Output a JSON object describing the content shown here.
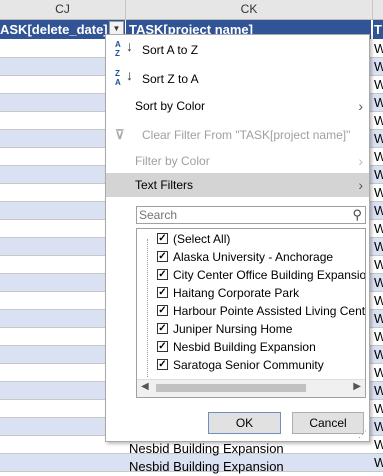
{
  "columns": {
    "cj": "CJ",
    "ck": "CK"
  },
  "table_header": {
    "left": "ASK[delete_date]",
    "middle": "TASK[project name]",
    "right": "T"
  },
  "grid": {
    "right_col": "W",
    "visible_bottom": [
      "Nesbid Building Expansion",
      "Nesbid Building Expansion"
    ]
  },
  "menu": {
    "sort_az": "Sort A to Z",
    "sort_za": "Sort Z to A",
    "sort_color": "Sort by Color",
    "clear_filter": "Clear Filter From \"TASK[project name]\"",
    "filter_color": "Filter by Color",
    "text_filters": "Text Filters",
    "search_placeholder": "Search",
    "items": [
      "(Select All)",
      "Alaska University - Anchorage",
      "City Center Office Building Expansio",
      "Haitang Corporate Park",
      "Harbour Pointe Assisted Living Cent",
      "Juniper Nursing Home",
      "Nesbid Building Expansion",
      "Saratoga Senior Community"
    ],
    "ok": "OK",
    "cancel": "Cancel"
  }
}
